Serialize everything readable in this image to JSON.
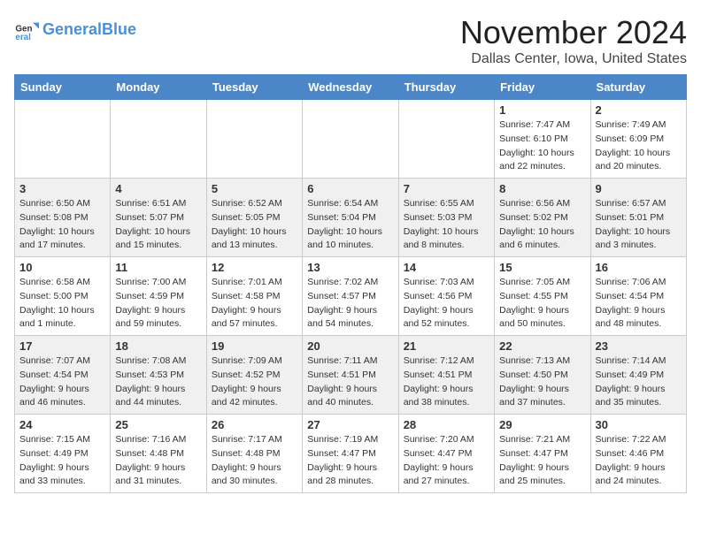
{
  "header": {
    "logo_line1": "General",
    "logo_line2": "Blue",
    "month_title": "November 2024",
    "location": "Dallas Center, Iowa, United States"
  },
  "days_of_week": [
    "Sunday",
    "Monday",
    "Tuesday",
    "Wednesday",
    "Thursday",
    "Friday",
    "Saturday"
  ],
  "weeks": [
    [
      {
        "day": "",
        "info": ""
      },
      {
        "day": "",
        "info": ""
      },
      {
        "day": "",
        "info": ""
      },
      {
        "day": "",
        "info": ""
      },
      {
        "day": "",
        "info": ""
      },
      {
        "day": "1",
        "info": "Sunrise: 7:47 AM\nSunset: 6:10 PM\nDaylight: 10 hours and 22 minutes."
      },
      {
        "day": "2",
        "info": "Sunrise: 7:49 AM\nSunset: 6:09 PM\nDaylight: 10 hours and 20 minutes."
      }
    ],
    [
      {
        "day": "3",
        "info": "Sunrise: 6:50 AM\nSunset: 5:08 PM\nDaylight: 10 hours and 17 minutes."
      },
      {
        "day": "4",
        "info": "Sunrise: 6:51 AM\nSunset: 5:07 PM\nDaylight: 10 hours and 15 minutes."
      },
      {
        "day": "5",
        "info": "Sunrise: 6:52 AM\nSunset: 5:05 PM\nDaylight: 10 hours and 13 minutes."
      },
      {
        "day": "6",
        "info": "Sunrise: 6:54 AM\nSunset: 5:04 PM\nDaylight: 10 hours and 10 minutes."
      },
      {
        "day": "7",
        "info": "Sunrise: 6:55 AM\nSunset: 5:03 PM\nDaylight: 10 hours and 8 minutes."
      },
      {
        "day": "8",
        "info": "Sunrise: 6:56 AM\nSunset: 5:02 PM\nDaylight: 10 hours and 6 minutes."
      },
      {
        "day": "9",
        "info": "Sunrise: 6:57 AM\nSunset: 5:01 PM\nDaylight: 10 hours and 3 minutes."
      }
    ],
    [
      {
        "day": "10",
        "info": "Sunrise: 6:58 AM\nSunset: 5:00 PM\nDaylight: 10 hours and 1 minute."
      },
      {
        "day": "11",
        "info": "Sunrise: 7:00 AM\nSunset: 4:59 PM\nDaylight: 9 hours and 59 minutes."
      },
      {
        "day": "12",
        "info": "Sunrise: 7:01 AM\nSunset: 4:58 PM\nDaylight: 9 hours and 57 minutes."
      },
      {
        "day": "13",
        "info": "Sunrise: 7:02 AM\nSunset: 4:57 PM\nDaylight: 9 hours and 54 minutes."
      },
      {
        "day": "14",
        "info": "Sunrise: 7:03 AM\nSunset: 4:56 PM\nDaylight: 9 hours and 52 minutes."
      },
      {
        "day": "15",
        "info": "Sunrise: 7:05 AM\nSunset: 4:55 PM\nDaylight: 9 hours and 50 minutes."
      },
      {
        "day": "16",
        "info": "Sunrise: 7:06 AM\nSunset: 4:54 PM\nDaylight: 9 hours and 48 minutes."
      }
    ],
    [
      {
        "day": "17",
        "info": "Sunrise: 7:07 AM\nSunset: 4:54 PM\nDaylight: 9 hours and 46 minutes."
      },
      {
        "day": "18",
        "info": "Sunrise: 7:08 AM\nSunset: 4:53 PM\nDaylight: 9 hours and 44 minutes."
      },
      {
        "day": "19",
        "info": "Sunrise: 7:09 AM\nSunset: 4:52 PM\nDaylight: 9 hours and 42 minutes."
      },
      {
        "day": "20",
        "info": "Sunrise: 7:11 AM\nSunset: 4:51 PM\nDaylight: 9 hours and 40 minutes."
      },
      {
        "day": "21",
        "info": "Sunrise: 7:12 AM\nSunset: 4:51 PM\nDaylight: 9 hours and 38 minutes."
      },
      {
        "day": "22",
        "info": "Sunrise: 7:13 AM\nSunset: 4:50 PM\nDaylight: 9 hours and 37 minutes."
      },
      {
        "day": "23",
        "info": "Sunrise: 7:14 AM\nSunset: 4:49 PM\nDaylight: 9 hours and 35 minutes."
      }
    ],
    [
      {
        "day": "24",
        "info": "Sunrise: 7:15 AM\nSunset: 4:49 PM\nDaylight: 9 hours and 33 minutes."
      },
      {
        "day": "25",
        "info": "Sunrise: 7:16 AM\nSunset: 4:48 PM\nDaylight: 9 hours and 31 minutes."
      },
      {
        "day": "26",
        "info": "Sunrise: 7:17 AM\nSunset: 4:48 PM\nDaylight: 9 hours and 30 minutes."
      },
      {
        "day": "27",
        "info": "Sunrise: 7:19 AM\nSunset: 4:47 PM\nDaylight: 9 hours and 28 minutes."
      },
      {
        "day": "28",
        "info": "Sunrise: 7:20 AM\nSunset: 4:47 PM\nDaylight: 9 hours and 27 minutes."
      },
      {
        "day": "29",
        "info": "Sunrise: 7:21 AM\nSunset: 4:47 PM\nDaylight: 9 hours and 25 minutes."
      },
      {
        "day": "30",
        "info": "Sunrise: 7:22 AM\nSunset: 4:46 PM\nDaylight: 9 hours and 24 minutes."
      }
    ]
  ]
}
